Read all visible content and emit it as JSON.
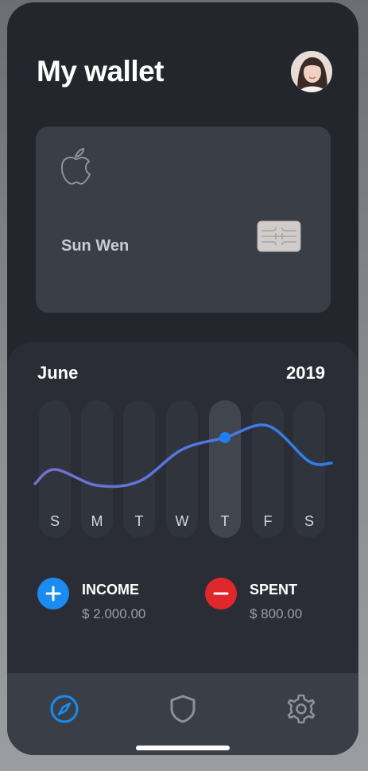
{
  "header": {
    "title": "My wallet"
  },
  "card": {
    "holder_name": "Sun Wen",
    "brand_icon": "apple-icon",
    "chip_icon": "card-chip-icon"
  },
  "calendar": {
    "month": "June",
    "year": "2019",
    "days": [
      "S",
      "M",
      "T",
      "W",
      "T",
      "F",
      "S"
    ],
    "selected_day_index": 4
  },
  "chart_data": {
    "type": "line",
    "categories": [
      "S",
      "M",
      "T",
      "W",
      "T",
      "F",
      "S"
    ],
    "series": [
      {
        "values": [
          0.35,
          0.15,
          0.2,
          0.6,
          0.75,
          0.9,
          0.45
        ]
      }
    ],
    "highlight_index": 4,
    "gradient": [
      "#7b6fd0",
      "#2a7ff0"
    ]
  },
  "income": {
    "label": "INCOME",
    "amount": "$ 2.000.00",
    "icon": "plus-icon",
    "color": "#1a8cf0"
  },
  "spent": {
    "label": "SPENT",
    "amount": "$ 800.00",
    "icon": "minus-icon",
    "color": "#e0282c"
  },
  "nav": {
    "items": [
      "compass-icon",
      "shield-icon",
      "gear-icon"
    ],
    "active_color": "#1a8cf0",
    "inactive_color": "#8c9098"
  }
}
